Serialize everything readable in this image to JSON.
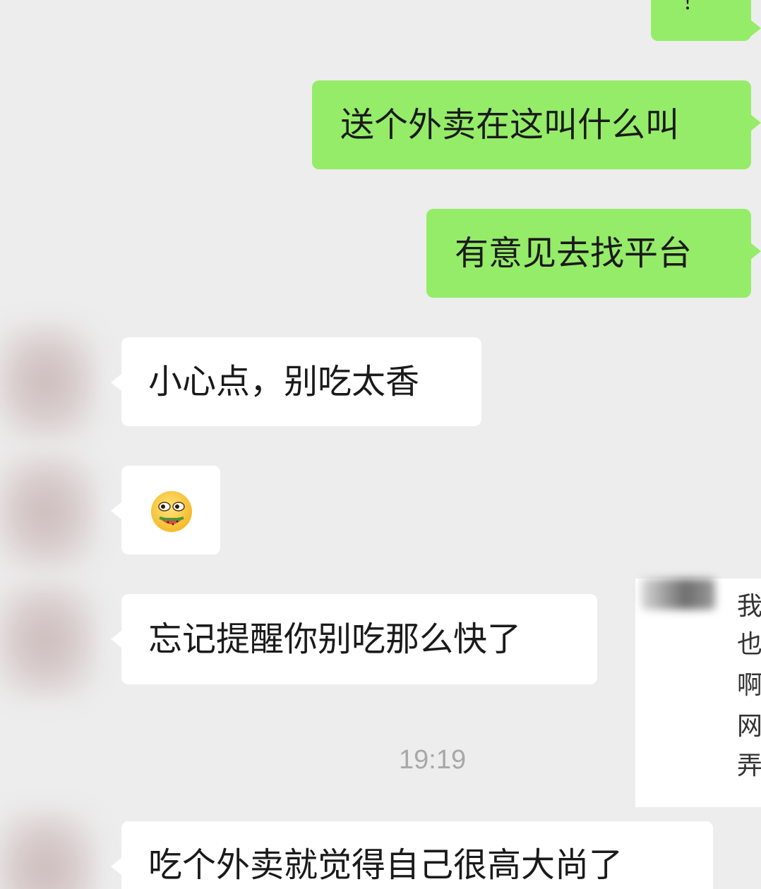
{
  "messages": {
    "m0": {
      "text": "！"
    },
    "m1": {
      "text": "送个外卖在这叫什么叫"
    },
    "m2": {
      "text": "有意见去找平台"
    },
    "m3": {
      "text": "小心点，别吃太香"
    },
    "m4": {
      "emoji": "eating-watermelon-emoji"
    },
    "m5": {
      "text": "忘记提醒你别吃那么快了"
    },
    "m6": {
      "text": "吃个外卖就觉得自己很高大尚了"
    }
  },
  "timestamp": "19:19",
  "overlay": {
    "chars": [
      "我",
      "也",
      "啊",
      "网",
      "弄"
    ]
  },
  "colors": {
    "outgoing_bubble": "#95ec69",
    "incoming_bubble": "#ffffff",
    "background": "#ededed"
  }
}
